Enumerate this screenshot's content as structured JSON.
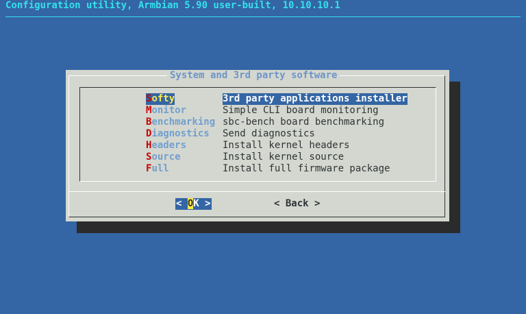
{
  "backtitle": "Configuration utility, Armbian 5.90 user-built, 10.10.10.1",
  "dialog": {
    "title": "System and 3rd party software"
  },
  "menu": {
    "selected_index": 0,
    "items": [
      {
        "hotkey": "S",
        "rest": "ofty",
        "description": "3rd party applications installer"
      },
      {
        "hotkey": "M",
        "rest": "onitor",
        "description": "Simple CLI board monitoring"
      },
      {
        "hotkey": "B",
        "rest": "enchmarking",
        "description": "sbc-bench board benchmarking"
      },
      {
        "hotkey": "D",
        "rest": "iagnostics",
        "description": "Send diagnostics"
      },
      {
        "hotkey": "H",
        "rest": "eaders",
        "description": "Install kernel headers"
      },
      {
        "hotkey": "S",
        "rest": "ource",
        "description": "Install kernel source"
      },
      {
        "hotkey": "F",
        "rest": "ull",
        "description": "Install full firmware package"
      }
    ]
  },
  "buttons": {
    "ok": {
      "left": "< ",
      "hot": "O",
      "rest": "K",
      "right": " >"
    },
    "back": {
      "left": "< ",
      "hot": "B",
      "rest": "ack",
      "right": " >"
    }
  },
  "colors": {
    "background": "#3465a4",
    "backtitle": "#36e0ec",
    "dialog": "#d3d7cf",
    "title": "#6e95c8",
    "tag": "#729fcf",
    "hotkey": "#cc0000",
    "highlight": "#3465a4",
    "highlight_text": "#fce94f"
  }
}
